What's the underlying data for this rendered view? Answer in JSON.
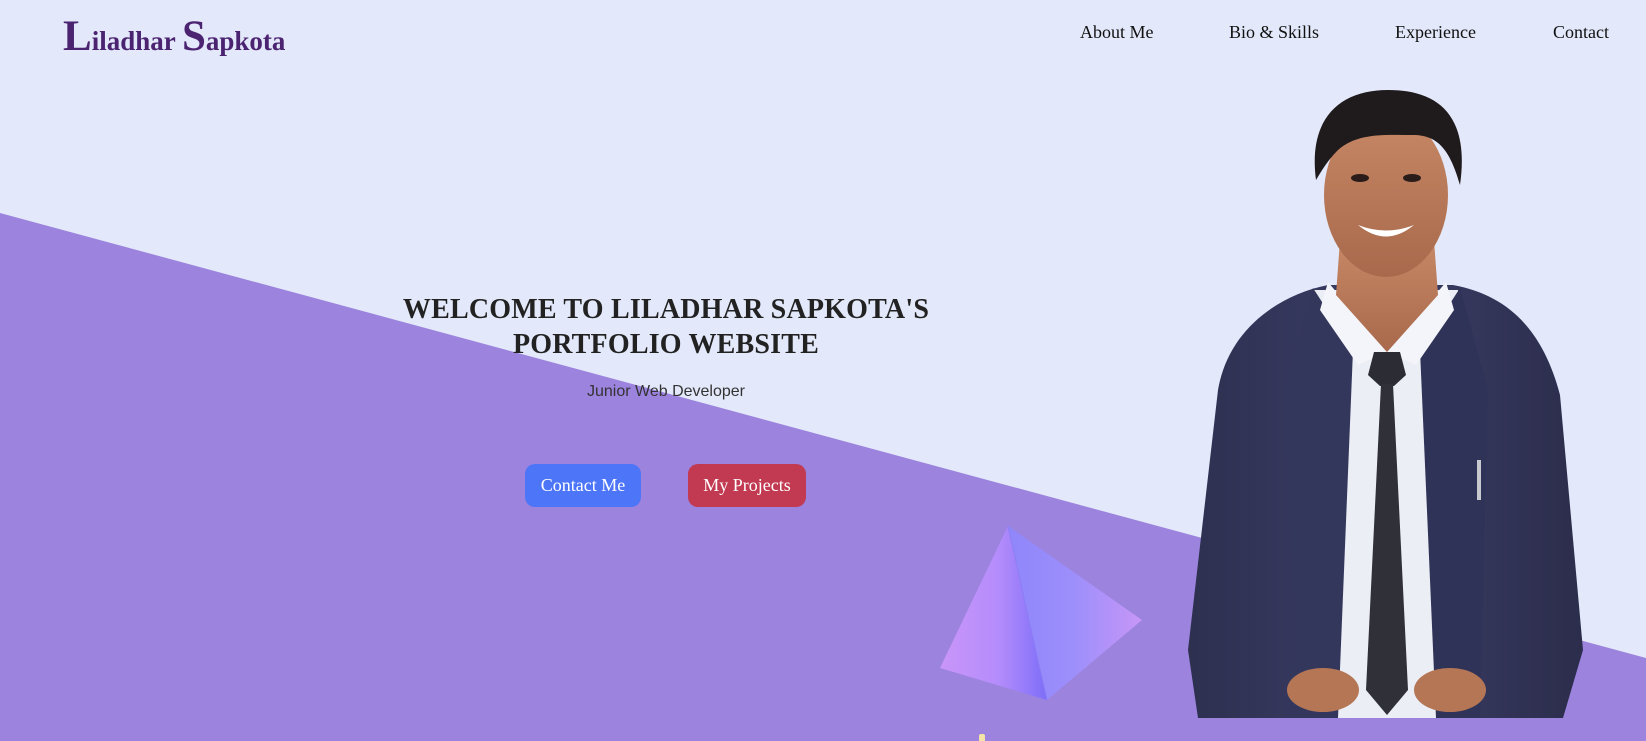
{
  "brand": {
    "first_initial": "L",
    "first_rest": "iladhar ",
    "last_initial": "S",
    "last_rest": "apkota"
  },
  "nav": {
    "items": [
      {
        "label": "About Me"
      },
      {
        "label": "Bio & Skills"
      },
      {
        "label": "Experience"
      },
      {
        "label": "Contact"
      }
    ]
  },
  "hero": {
    "title_line1": "WELCOME TO LILADHAR SAPKOTA'S",
    "title_line2": "PORTFOLIO WEBSITE",
    "subtitle": "Junior Web Developer",
    "contact_button": "Contact Me",
    "projects_button": "My Projects"
  },
  "colors": {
    "background": "#e3e9fa",
    "diagonal": "#9b83de",
    "brand": "#4b2370",
    "contact_button": "#4d75f7",
    "projects_button": "#c13a52"
  }
}
